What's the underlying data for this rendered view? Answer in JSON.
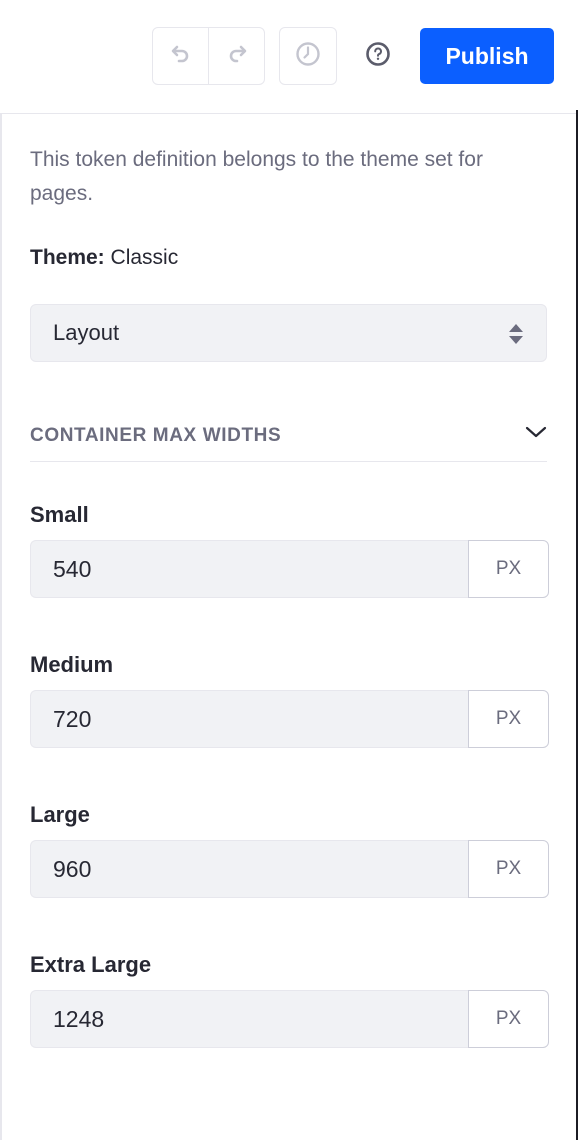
{
  "toolbar": {
    "undo_icon": "undo-icon",
    "redo_icon": "redo-icon",
    "history_icon": "clock-icon",
    "help_icon": "question-circle-icon",
    "publish_label": "Publish",
    "accent_color": "#0b5fff"
  },
  "panel": {
    "description": "This token definition belongs to the theme set for pages.",
    "theme_label": "Theme:",
    "theme_value": "Classic",
    "category_select": {
      "selected": "Layout"
    },
    "section": {
      "title": "CONTAINER MAX WIDTHS",
      "expanded": true
    },
    "fields": [
      {
        "label": "Small",
        "value": "540",
        "unit": "PX"
      },
      {
        "label": "Medium",
        "value": "720",
        "unit": "PX"
      },
      {
        "label": "Large",
        "value": "960",
        "unit": "PX"
      },
      {
        "label": "Extra Large",
        "value": "1248",
        "unit": "PX"
      }
    ]
  }
}
